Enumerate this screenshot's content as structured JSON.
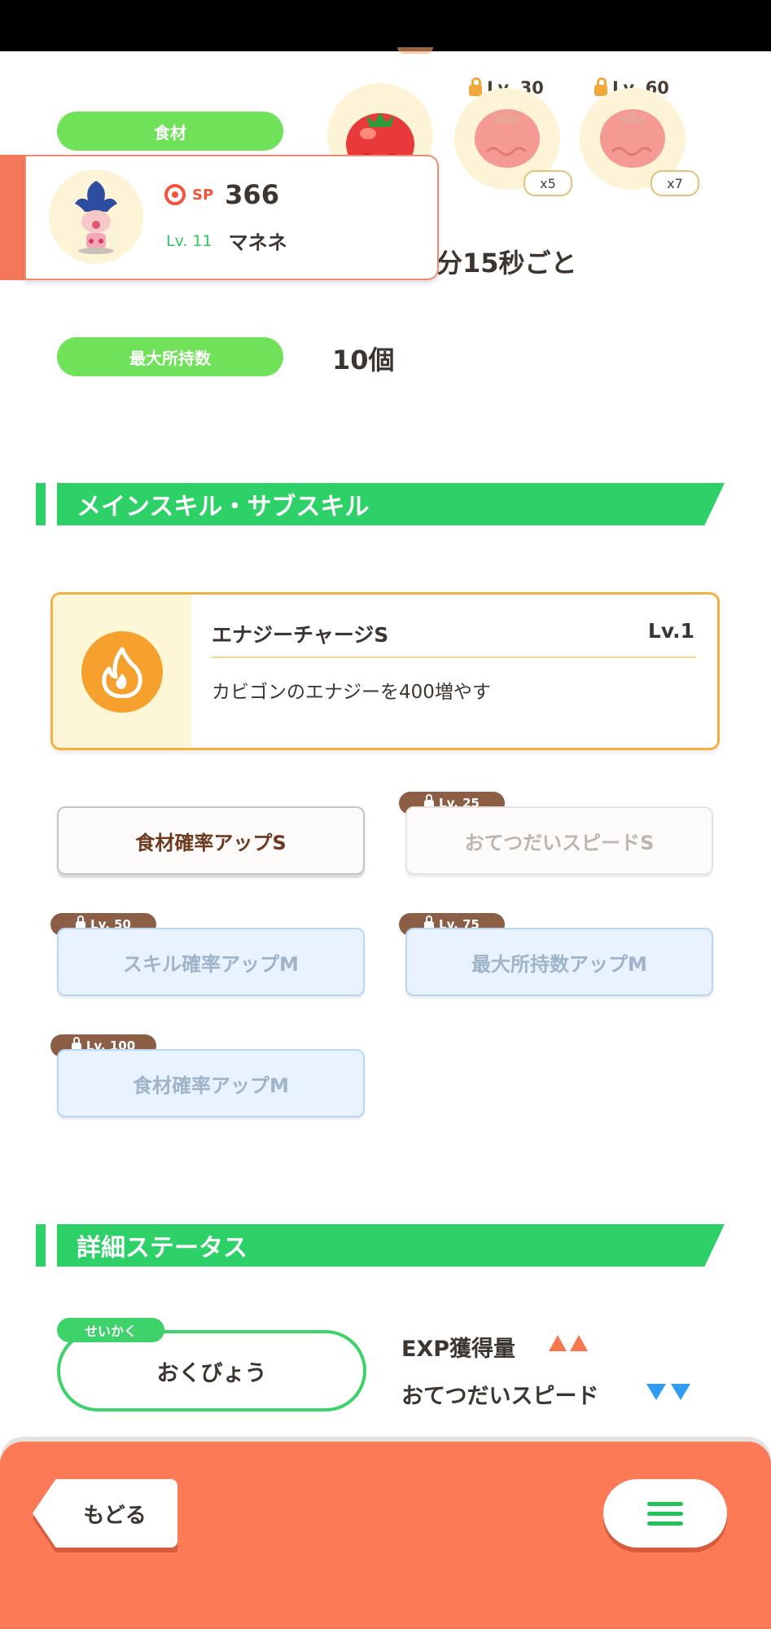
{
  "ingredient": {
    "label": "食材",
    "slots": [
      {
        "icon": "tomato-icon",
        "lock": "",
        "count": ""
      },
      {
        "icon": "tomato-icon",
        "lock": "Lv. 30",
        "count": "x5"
      },
      {
        "icon": "tomato-icon",
        "lock": "Lv. 60",
        "count": "x7"
      }
    ]
  },
  "frequency": {
    "value_partial": "分15秒ごと"
  },
  "max_hold": {
    "label": "最大所持数",
    "value": "10個"
  },
  "profile": {
    "sp_label": "SP",
    "sp_value": "366",
    "level": "Lv. 11",
    "name": "マネネ"
  },
  "skills_section": {
    "title": "メインスキル・サブスキル",
    "main_skill": {
      "name": "エナジーチャージS",
      "level": "Lv.1",
      "description": "カビゴンのエナジーを400増やす",
      "icon": "flame-icon"
    },
    "sub_skills": [
      {
        "name": "食材確率アップS",
        "lock": ""
      },
      {
        "name": "おてつだいスピードS",
        "lock": "Lv. 25"
      },
      {
        "name": "スキル確率アップM",
        "lock": "Lv. 50"
      },
      {
        "name": "最大所持数アップM",
        "lock": "Lv. 75"
      },
      {
        "name": "食材確率アップM",
        "lock": "Lv. 100"
      }
    ]
  },
  "status_section": {
    "title": "詳細ステータス",
    "nature_tag": "せいかく",
    "nature": "おくびょう",
    "up_stat": "EXP獲得量",
    "down_stat": "おてつだいスピード",
    "colors": {
      "up": "#f5774d",
      "down": "#2f9cf2"
    }
  },
  "footer": {
    "back_label": "もどる",
    "menu_icon": "hamburger-menu-icon"
  }
}
